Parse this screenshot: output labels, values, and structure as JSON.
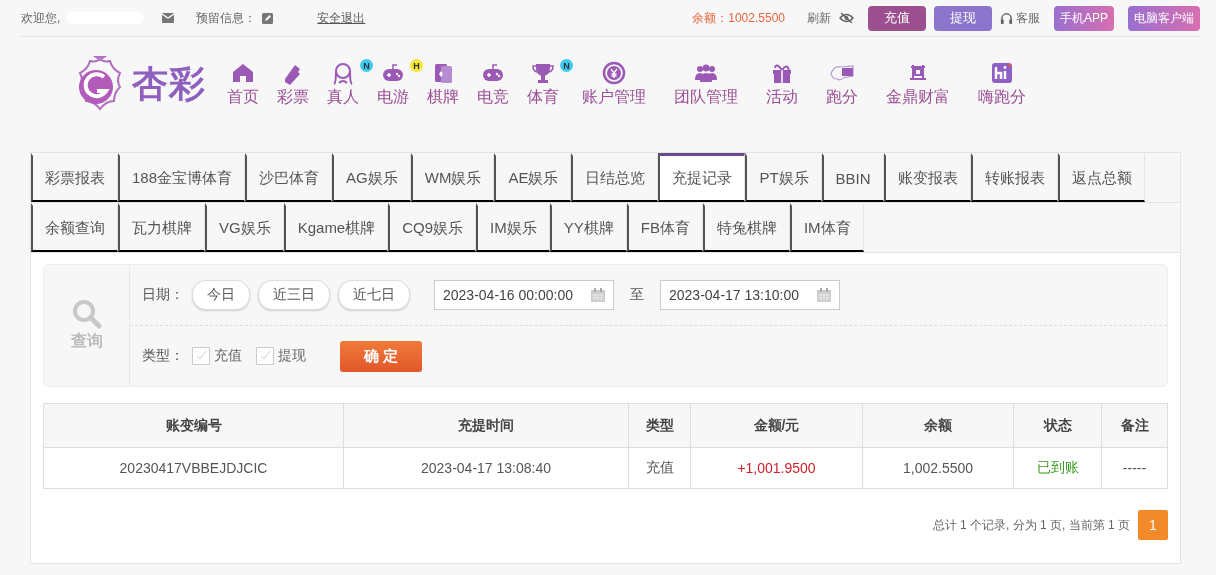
{
  "top_bar": {
    "greeting": "欢迎您,",
    "reserved_label": "预留信息：",
    "logout": "安全退出",
    "balance": "余额：1002.5500",
    "refresh": "刷新",
    "actions": [
      {
        "label": "充值",
        "kind": "recharge"
      },
      {
        "label": "提现",
        "kind": "withdraw"
      },
      {
        "label": "客服",
        "kind": "support"
      },
      {
        "label": "手机APP",
        "kind": "gradient"
      },
      {
        "label": "电脑客户端",
        "kind": "gradient"
      }
    ]
  },
  "nav": {
    "logo": "杏彩",
    "items": [
      {
        "label": "首页"
      },
      {
        "label": "彩票"
      },
      {
        "label": "真人",
        "badge": {
          "label": "N",
          "color": "#3fc8f0"
        }
      },
      {
        "label": "电游",
        "badge": {
          "label": "H",
          "color": "#f5e63a"
        }
      },
      {
        "label": "棋牌"
      },
      {
        "label": "电竞"
      },
      {
        "label": "体育",
        "badge": {
          "label": "N",
          "color": "#3fc8f0"
        }
      },
      {
        "label": "账户管理"
      },
      {
        "label": "团队管理"
      },
      {
        "label": "活动"
      },
      {
        "label": "跑分"
      },
      {
        "label": "金鼎财富"
      },
      {
        "label": "嗨跑分"
      }
    ]
  },
  "tab_rows": [
    {
      "tabs": [
        {
          "label": "彩票报表",
          "selected": false
        },
        {
          "label": "188金宝博体育",
          "selected": false
        },
        {
          "label": "沙巴体育",
          "selected": false
        },
        {
          "label": "AG娱乐",
          "selected": false
        },
        {
          "label": "WM娱乐",
          "selected": false
        },
        {
          "label": "AE娱乐",
          "selected": false
        },
        {
          "label": "日结总览",
          "selected": false
        },
        {
          "label": "充提记录",
          "selected": true
        },
        {
          "label": "PT娱乐",
          "selected": false
        },
        {
          "label": "BBIN",
          "selected": false
        },
        {
          "label": "账变报表",
          "selected": false
        },
        {
          "label": "转账报表",
          "selected": false
        },
        {
          "label": "返点总额",
          "selected": false
        }
      ]
    },
    {
      "tabs": [
        {
          "label": "余额查询",
          "selected": false
        },
        {
          "label": "瓦力棋牌",
          "selected": false
        },
        {
          "label": "VG娱乐",
          "selected": false
        },
        {
          "label": "Kgame棋牌",
          "selected": false
        },
        {
          "label": "CQ9娱乐",
          "selected": false
        },
        {
          "label": "IM娱乐",
          "selected": false
        },
        {
          "label": "YY棋牌",
          "selected": false
        },
        {
          "label": "FB体育",
          "selected": false
        },
        {
          "label": "特兔棋牌",
          "selected": false
        },
        {
          "label": "IM体育",
          "selected": false
        }
      ]
    }
  ],
  "query": {
    "label": "查询",
    "date_label": "日期：",
    "quick_ranges": [
      "今日",
      "近三日",
      "近七日"
    ],
    "start": "2023-04-16 00:00:00",
    "to": "至",
    "end": "2023-04-17 13:10:00",
    "type_label": "类型：",
    "types": [
      {
        "label": "充值",
        "checked": false
      },
      {
        "label": "提现",
        "checked": false
      }
    ],
    "confirm": "确 定"
  },
  "table": {
    "columns": [
      "账变编号",
      "充提时间",
      "类型",
      "金额/元",
      "余额",
      "状态",
      "备注"
    ],
    "rows": [
      {
        "cells": [
          "20230417VBBEJDJCIC",
          "2023-04-17 13:08:40",
          "充值",
          "+1,001.9500",
          "1,002.5500",
          "已到账",
          "-----"
        ]
      }
    ]
  },
  "pagination": {
    "summary": "总计 1 个记录, 分为 1 页, 当前第 1 页",
    "pages": [
      {
        "label": "1",
        "selected": true
      }
    ]
  }
}
